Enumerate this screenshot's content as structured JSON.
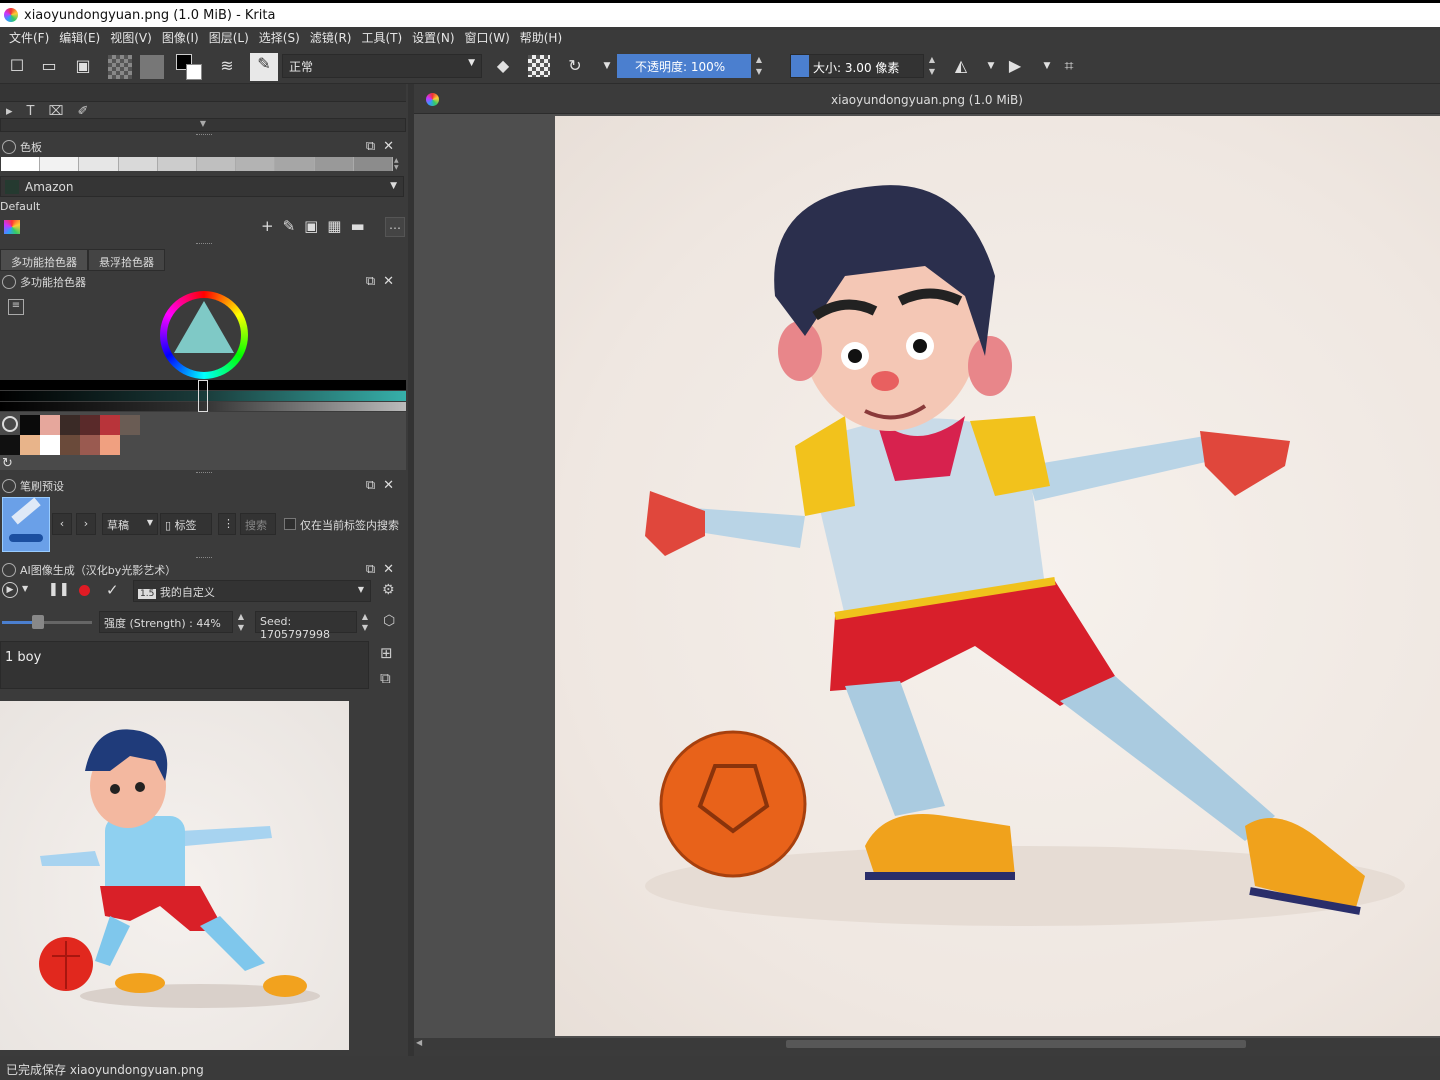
{
  "window": {
    "title": "xiaoyundongyuan.png (1.0 MiB)  - Krita"
  },
  "menu": [
    "文件(F)",
    "编辑(E)",
    "视图(V)",
    "图像(I)",
    "图层(L)",
    "选择(S)",
    "滤镜(R)",
    "工具(T)",
    "设置(N)",
    "窗口(W)",
    "帮助(H)"
  ],
  "toolbar": {
    "blend_mode": "正常",
    "opacity_label": "不透明度:  100%",
    "size_label": "大小:  3.00 像素"
  },
  "palette": {
    "title": "色板",
    "selected": "Amazon",
    "group": "Default"
  },
  "selector_tabs": [
    "多功能拾色器",
    "悬浮拾色器"
  ],
  "color_selector": {
    "title": "多功能拾色器"
  },
  "brush_presets": {
    "title": "笔刷预设",
    "filter_value": "草稿",
    "tag_label": "标签",
    "search_placeholder": "搜索",
    "only_current_tag": "仅在当前标签内搜索"
  },
  "ai_docker": {
    "title": "AI图像生成（汉化by光影艺术）",
    "style_value": "我的自定义",
    "style_badge": "1.5",
    "strength_label": "强度 (Strength) : 44%",
    "strength": 0.44,
    "seed_label": "Seed: 1705797998",
    "prompt": "1 boy"
  },
  "canvas": {
    "title": "xiaoyundongyuan.png (1.0 MiB)"
  },
  "status": {
    "message": "已完成保存 xiaoyundongyuan.png"
  },
  "recent_colors": [
    "#0a0a0a",
    "#e6a79c",
    "#3a2a26",
    "#5a2a2a",
    "#b8343a",
    "#6a5c54",
    "#101010",
    "#e8b48a",
    "#ffffff",
    "#6a4a3a",
    "#9a5a50",
    "#f0a080"
  ],
  "colors": {
    "accent": "#4b7fcf",
    "background": "#3b3b3b"
  }
}
